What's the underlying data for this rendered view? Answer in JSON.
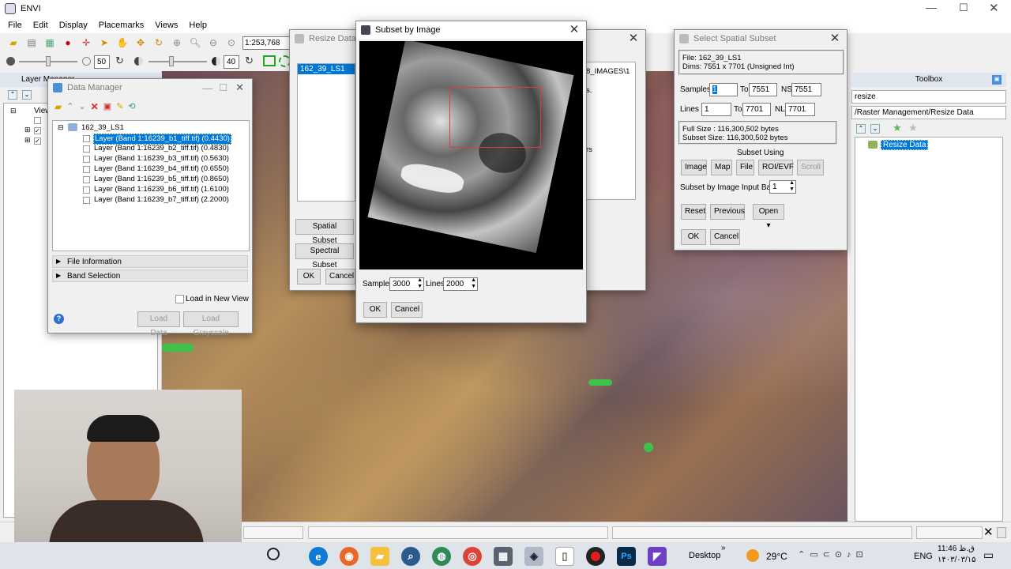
{
  "app": {
    "title": "ENVI",
    "menus": [
      "File",
      "Edit",
      "Display",
      "Placemarks",
      "Views",
      "Help"
    ]
  },
  "toolbar": {
    "scale": "1:253,768",
    "zoom_value": "50",
    "stretch_value": "40"
  },
  "layer_manager": {
    "title": "Layer Manager",
    "view_label": "View"
  },
  "data_manager": {
    "title": "Data Manager",
    "root": "162_39_LS1",
    "layers": [
      "Layer (Band 1:16239_b1_tiff.tif) (0.4430)",
      "Layer (Band 1:16239_b2_tiff.tif) (0.4830)",
      "Layer (Band 1:16239_b3_tiff.tif) (0.5630)",
      "Layer (Band 1:16239_b4_tiff.tif) (0.6550)",
      "Layer (Band 1:16239_b5_tiff.tif) (0.8650)",
      "Layer (Band 1:16239_b6_tiff.tif) (1.6100)",
      "Layer (Band 1:16239_b7_tiff.tif) (2.2000)"
    ],
    "file_info": "File Information",
    "band_selection": "Band Selection",
    "load_new_view": "Load in New View",
    "load_data": "Load Data",
    "load_grayscale": "Load Grayscale"
  },
  "resize_data": {
    "title": "Resize Data In",
    "selected": "162_39_LS1",
    "path_fragment": "8_IMAGES\\1",
    "spatial_subset": "Spatial Subset",
    "spectral_subset": "Spectral Subset",
    "ok": "OK",
    "cancel": "Cancel",
    "frag_s": "s.",
    "frag_rs": "rs"
  },
  "subset_by_image": {
    "title": "Subset by Image",
    "samples_label": "Samples",
    "samples_value": "3000",
    "lines_label": "Lines",
    "lines_value": "2000",
    "ok": "OK",
    "cancel": "Cancel"
  },
  "spatial_subset": {
    "title": "Select Spatial Subset",
    "file": "File: 162_39_LS1",
    "dims": "Dims: 7551 x 7701 (Unsigned Int)",
    "samples_label": "Samples",
    "samples_from": "1",
    "to_label": "To",
    "samples_to": "7551",
    "ns_label": "NS",
    "ns": "7551",
    "lines_label": "Lines",
    "lines_from": "1",
    "lines_to": "7701",
    "nl_label": "NL",
    "nl": "7701",
    "full_size": "Full Size  : 116,300,502 bytes",
    "subset_size": "Subset Size: 116,300,502 bytes",
    "subset_using": "Subset Using",
    "buttons": [
      "Image",
      "Map",
      "File",
      "ROI/EVF",
      "Scroll"
    ],
    "input_band_label": "Subset by Image Input Band",
    "input_band": "1",
    "reset": "Reset",
    "previous": "Previous",
    "open": "Open ▾",
    "ok": "OK",
    "cancel": "Cancel"
  },
  "toolbox": {
    "title": "Toolbox",
    "search": "resize",
    "path": "/Raster Management/Resize Data",
    "item": "Resize Data"
  },
  "taskbar": {
    "desktop": "Desktop",
    "temperature": "29°C",
    "lang": "ENG",
    "time": "11:46 ق.ظ",
    "date": "۱۴۰۳/۰۳/۱۵"
  },
  "colors": {
    "selection": "#0078d7",
    "title_active": "#ffffff",
    "subset_box": "#e03a3a"
  }
}
